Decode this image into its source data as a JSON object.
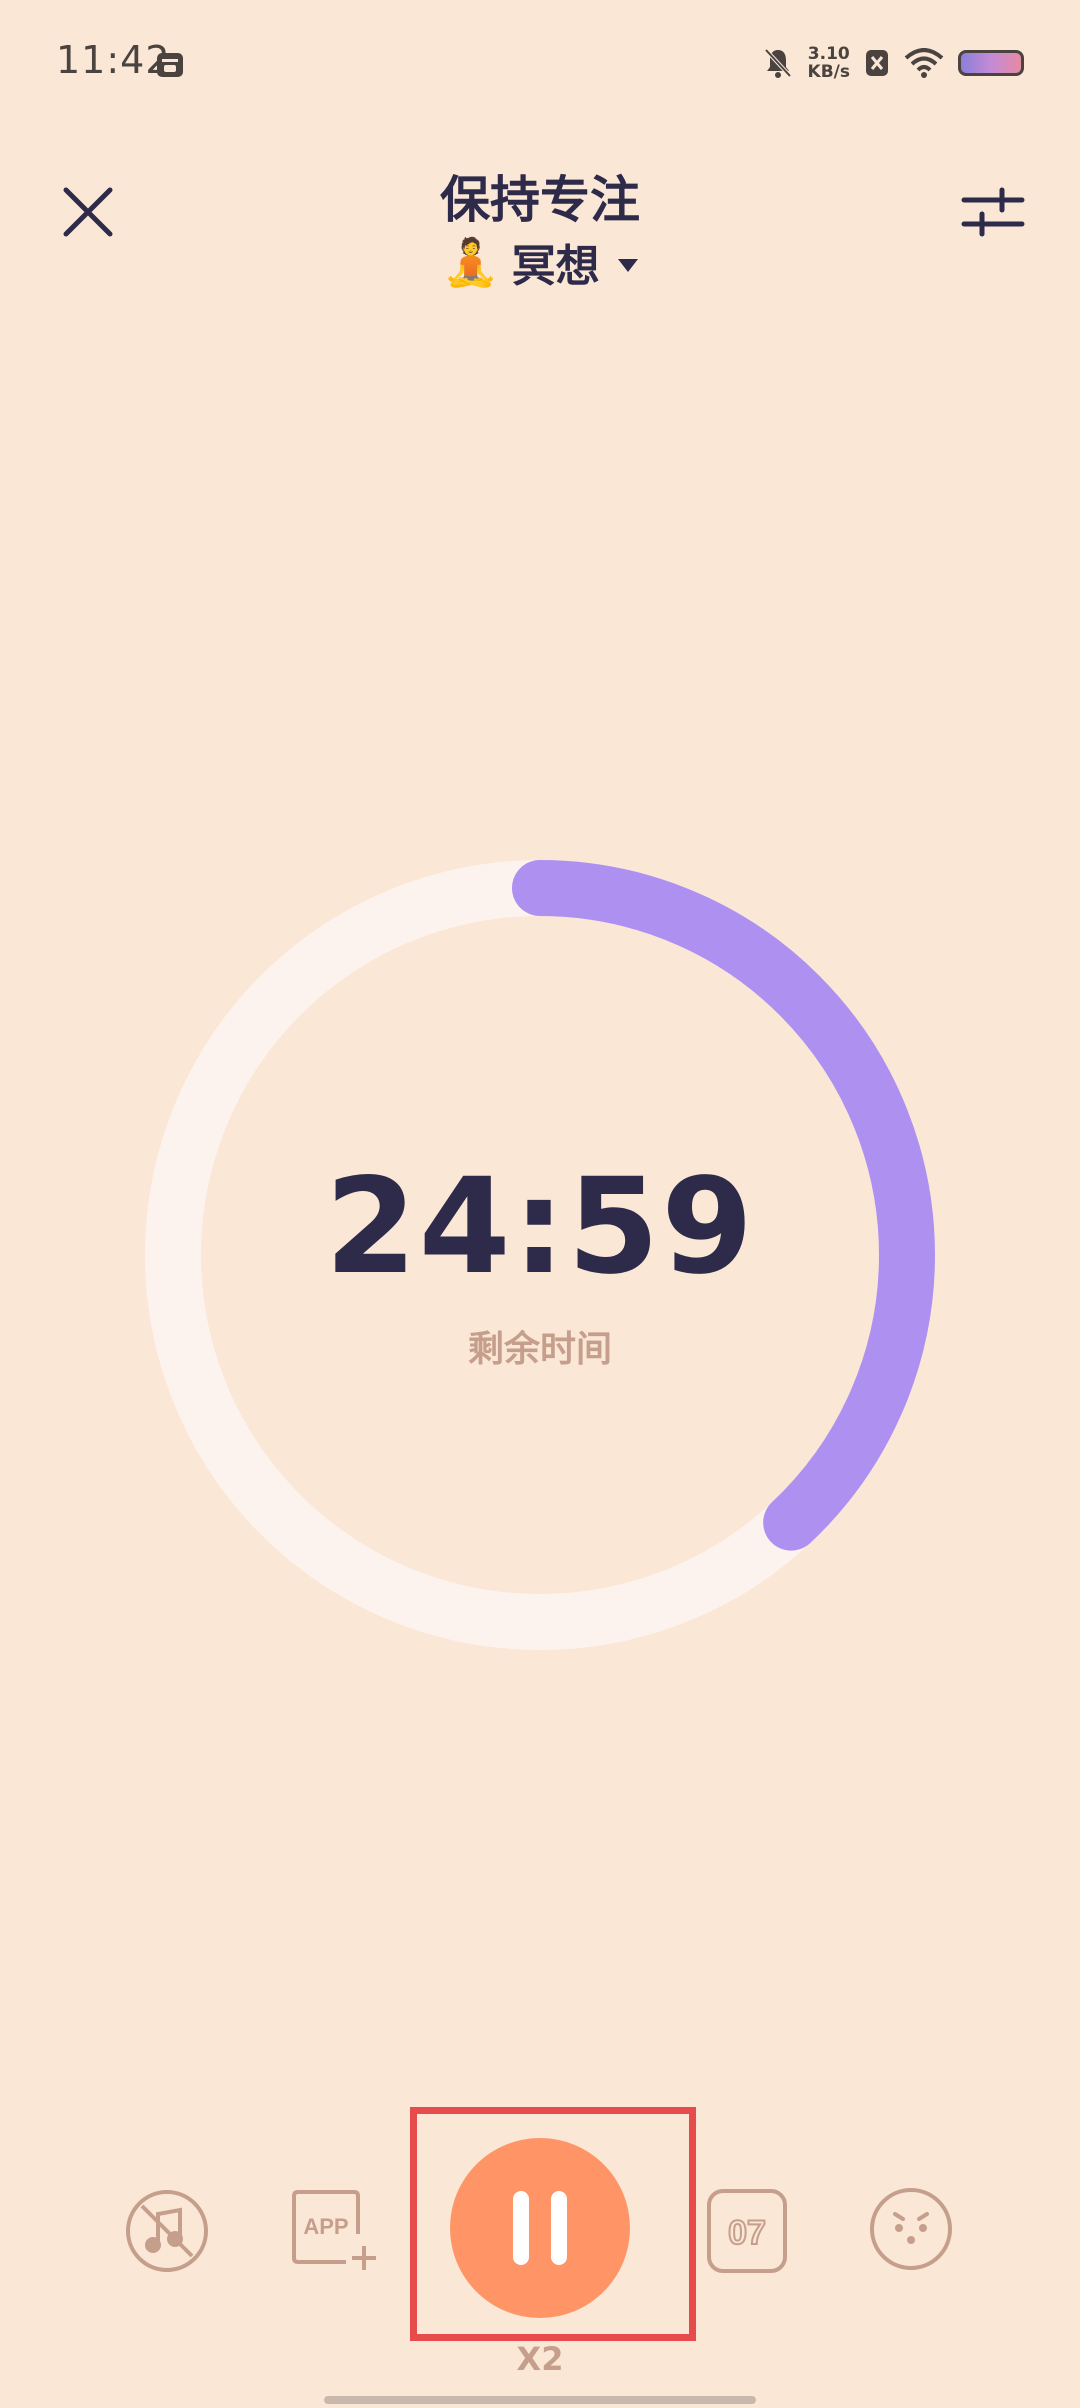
{
  "status_bar": {
    "time": "11:42",
    "network_speed_value": "3.10",
    "network_speed_unit": "KB/s",
    "icons": [
      "mute-bell-icon",
      "sim-x-icon",
      "wifi-icon",
      "battery-icon"
    ]
  },
  "header": {
    "title": "保持专注",
    "activity_emoji": "🧘",
    "activity_label": "冥想",
    "close_icon": "close-icon",
    "settings_icon": "sliders-icon"
  },
  "timer": {
    "remaining": "24:59",
    "caption": "剩余时间",
    "progress_fraction": 0.38,
    "track_color": "#FDF3EE",
    "progress_color": "#AE90F1"
  },
  "controls": {
    "items": [
      "music-off-icon",
      "app-add-icon",
      "pause-icon",
      "calendar-07-icon",
      "pet-face-icon"
    ],
    "app_label": "APP",
    "date_label": "07",
    "speed_label": "X2",
    "accent_color": "#FF9566"
  }
}
